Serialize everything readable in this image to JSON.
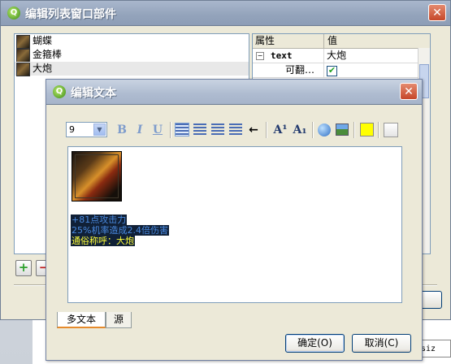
{
  "outer_window": {
    "title": "编辑列表窗口部件",
    "list_items": [
      {
        "label": "蝴蝶"
      },
      {
        "label": "金箍棒"
      },
      {
        "label": "大炮"
      }
    ],
    "property_table": {
      "headers": [
        "属性",
        "值"
      ],
      "rows": [
        {
          "name": "text",
          "value": "大炮",
          "expanded": true
        },
        {
          "name": "可翻…",
          "value": "✔"
        }
      ]
    },
    "add_button": "+",
    "remove_button": "−",
    "close_button": "✕",
    "icon_glyph": "Q"
  },
  "background": {
    "size_fragment": "siz"
  },
  "text_dialog": {
    "title": "编辑文本",
    "close_button": "✕",
    "icon_glyph": "Q",
    "toolbar": {
      "font_size": "9",
      "bold": "B",
      "italic": "I",
      "underline": "U",
      "arrow": "←",
      "superscript": "A¹",
      "subscript": "A₁",
      "highlight_color": "#ffff00"
    },
    "editor": {
      "lines": [
        "+81点攻击力",
        "25%机率造成2.4倍伤害",
        "通俗称呼：大炮"
      ]
    },
    "tabs": [
      "多文本",
      "源"
    ],
    "ok_label": "确定(O)",
    "cancel_label": "取消(C)"
  }
}
